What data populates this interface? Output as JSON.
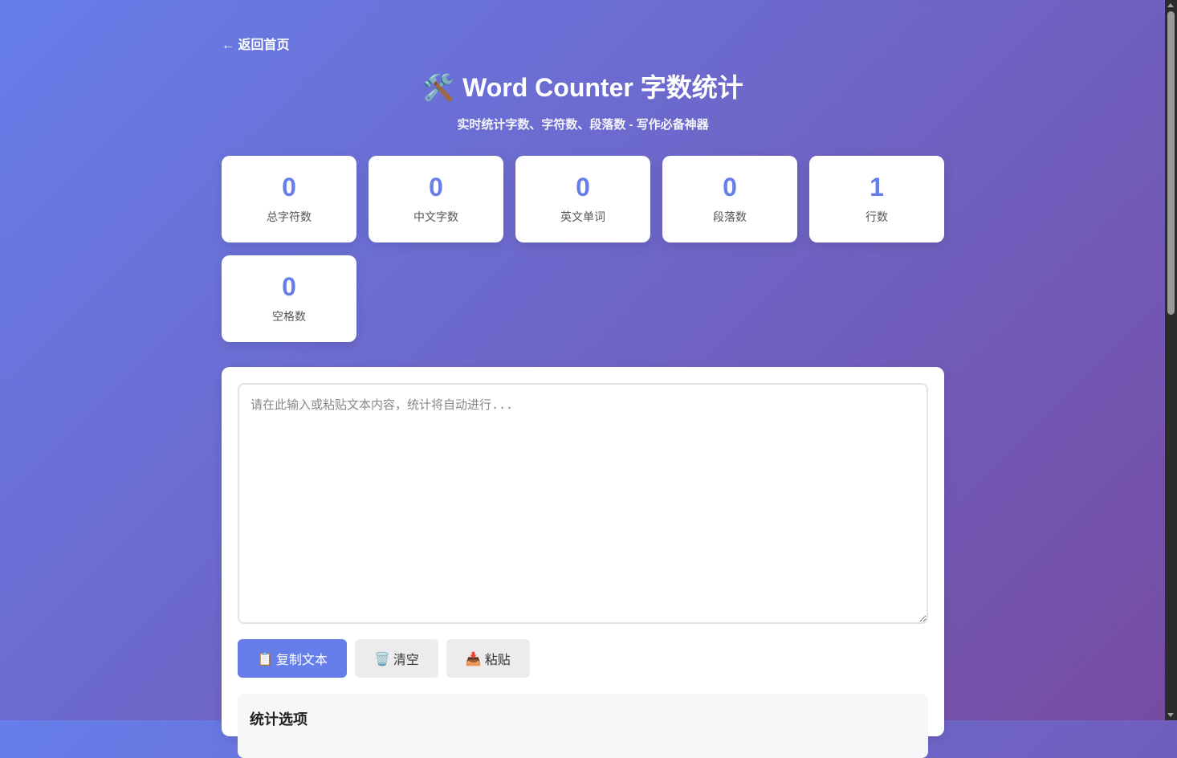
{
  "nav": {
    "back_label": "← 返回首页"
  },
  "header": {
    "icon": "🛠️",
    "icon_name": "tools-icon",
    "title": "Word Counter 字数统计",
    "subtitle": "实时统计字数、字符数、段落数 - 写作必备神器"
  },
  "stats": [
    {
      "value": "0",
      "label": "总字符数"
    },
    {
      "value": "0",
      "label": "中文字数"
    },
    {
      "value": "0",
      "label": "英文单词"
    },
    {
      "value": "0",
      "label": "段落数"
    },
    {
      "value": "1",
      "label": "行数"
    },
    {
      "value": "0",
      "label": "空格数"
    }
  ],
  "editor": {
    "placeholder": "请在此输入或粘贴文本内容，统计将自动进行...",
    "value": ""
  },
  "buttons": {
    "copy": {
      "icon": "📋",
      "icon_name": "clipboard-icon",
      "label": "复制文本"
    },
    "clear": {
      "icon": "🗑️",
      "icon_name": "trash-icon",
      "label": "清空"
    },
    "paste": {
      "icon": "📥",
      "icon_name": "inbox-icon",
      "label": "粘贴"
    }
  },
  "options": {
    "title": "统计选项"
  },
  "colors": {
    "accent": "#667eea",
    "gradient_start": "#667eea",
    "gradient_end": "#764ba2"
  }
}
